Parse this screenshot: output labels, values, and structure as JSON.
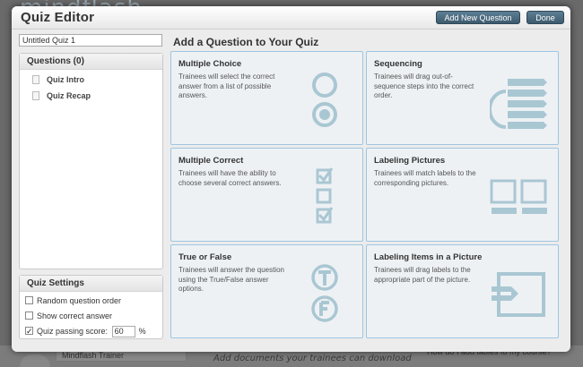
{
  "background": {
    "logo_text": "mindflash",
    "trainer_label": "Mindflash Trainer",
    "docs_hint": "Add documents your trainees can download",
    "help_link": "How do I add tables to my course?"
  },
  "dialog": {
    "title": "Quiz Editor",
    "add_button": "Add New Question",
    "done_button": "Done"
  },
  "quiz": {
    "name_value": "Untitled Quiz 1"
  },
  "questions": {
    "header": "Questions (0)",
    "items": [
      {
        "label": "Quiz Intro"
      },
      {
        "label": "Quiz Recap"
      }
    ]
  },
  "settings": {
    "header": "Quiz Settings",
    "random_order_label": "Random question order",
    "show_answer_label": "Show correct answer",
    "passing_score_label": "Quiz passing score:",
    "passing_score_value": "60",
    "percent_symbol": "%",
    "random_order_checked": false,
    "show_answer_checked": false,
    "passing_score_checked": true
  },
  "main": {
    "title": "Add a Question to Your Quiz",
    "cards": [
      {
        "title": "Multiple Choice",
        "desc": "Trainees will select the correct answer from a list of possible answers.",
        "icon": "multiple-choice-icon"
      },
      {
        "title": "Sequencing",
        "desc": "Trainees will drag out-of-sequence steps into the correct order.",
        "icon": "sequencing-icon"
      },
      {
        "title": "Multiple Correct",
        "desc": "Trainees will have the ability to choose several correct answers.",
        "icon": "multiple-correct-icon"
      },
      {
        "title": "Labeling Pictures",
        "desc": "Trainees will match labels to the corresponding pictures.",
        "icon": "labeling-pictures-icon"
      },
      {
        "title": "True or False",
        "desc": "Trainees will answer the question using the True/False answer options.",
        "icon": "true-false-icon"
      },
      {
        "title": "Labeling Items in a Picture",
        "desc": "Trainees will drag labels to the appropriate part of the picture.",
        "icon": "labeling-items-icon"
      }
    ]
  },
  "colors": {
    "icon": "#a9c7d3",
    "accent_button": "#4a6a7e",
    "card_border": "#9ec6e0"
  }
}
